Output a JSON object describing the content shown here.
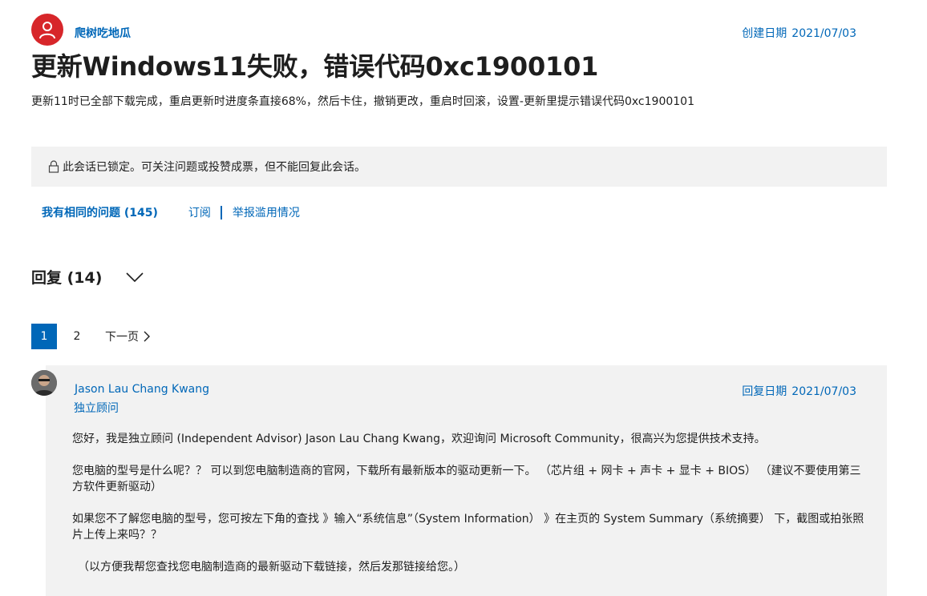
{
  "author": {
    "name": "爬树吃地瓜",
    "avatar_color": "#d7262a",
    "avatar_icon": "person-icon"
  },
  "created": {
    "label": "创建日期",
    "date": "2021/07/03"
  },
  "question": {
    "title": "更新Windows11失败，错误代码0xc1900101",
    "description": "更新11时已全部下载完成，重启更新时进度条直接68%，然后卡住，撤销更改，重启时回滚，设置-更新里提示错误代码0xc1900101"
  },
  "lock_banner": {
    "icon": "lock-icon",
    "text": "此会话已锁定。可关注问题或投赞成票，但不能回复此会话。"
  },
  "actions": {
    "same_question": "我有相同的问题 (145)",
    "subscribe": "订阅",
    "report": "举报滥用情况"
  },
  "replies": {
    "title": "回复 (14)",
    "toggle_icon": "chevron-down-icon"
  },
  "pagination": {
    "pages": [
      "1",
      "2"
    ],
    "current": "1",
    "next_label": "下一页"
  },
  "reply": {
    "author": "Jason Lau Chang Kwang",
    "role": "独立顾问",
    "date_label": "回复日期",
    "date": "2021/07/03",
    "paragraphs": [
      "您好，我是独立顾问 (Independent Advisor) Jason Lau Chang Kwang，欢迎询问 Microsoft Community，很高兴为您提供技术支持。",
      "您电脑的型号是什么呢？？ 可以到您电脑制造商的官网，下载所有最新版本的驱动更新一下。 （芯片组 + 网卡 + 声卡 + 显卡 + BIOS） （建议不要使用第三方软件更新驱动）",
      "如果您不了解您电脑的型号，您可按左下角的查找 》输入“系统信息”（System Information） 》在主页的 System Summary（系统摘要） 下，截图或拍张照片上传上来吗？？",
      "（以方便我帮您查找您电脑制造商的最新驱动下载链接，然后发那链接给您。）"
    ]
  },
  "colors": {
    "link": "#0067b8",
    "banner_bg": "#f2f2f2",
    "text": "#1e1e1e"
  }
}
